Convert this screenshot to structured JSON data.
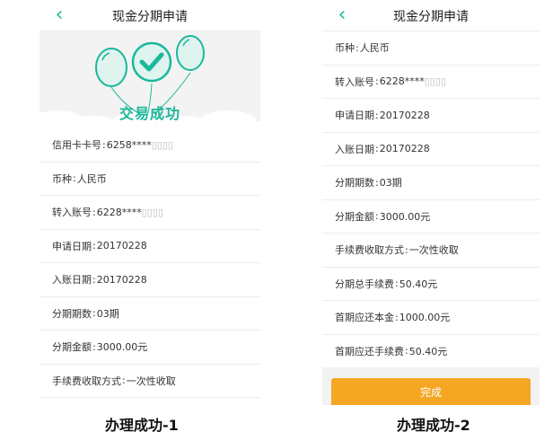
{
  "colors": {
    "accent": "#1bb89c",
    "button": "#f5a623"
  },
  "left": {
    "nav": {
      "title": "现金分期申请",
      "back_icon": "chevron-left-icon"
    },
    "success_text": "交易成功",
    "rows": [
      {
        "label": "信用卡卡号",
        "value": "6258****"
      },
      {
        "label": "币种",
        "value": "人民币"
      },
      {
        "label": "转入账号",
        "value": "6228****"
      },
      {
        "label": "申请日期",
        "value": "20170228"
      },
      {
        "label": "入账日期",
        "value": "20170228"
      },
      {
        "label": "分期期数",
        "value": "03期"
      },
      {
        "label": "分期金额",
        "value": "3000.00元"
      },
      {
        "label": "手续费收取方式",
        "value": "一次性收取"
      }
    ],
    "caption": "办理成功-1"
  },
  "right": {
    "nav": {
      "title": "现金分期申请",
      "back_icon": "chevron-left-icon"
    },
    "rows": [
      {
        "label": "币种",
        "value": "人民币"
      },
      {
        "label": "转入账号",
        "value": "6228****"
      },
      {
        "label": "申请日期",
        "value": "20170228"
      },
      {
        "label": "入账日期",
        "value": "20170228"
      },
      {
        "label": "分期期数",
        "value": "03期"
      },
      {
        "label": "分期金额",
        "value": "3000.00元"
      },
      {
        "label": "手续费收取方式",
        "value": "一次性收取"
      },
      {
        "label": "分期总手续费",
        "value": "50.40元"
      },
      {
        "label": "首期应还本金",
        "value": "1000.00元"
      },
      {
        "label": "首期应还手续费",
        "value": "50.40元"
      }
    ],
    "done_label": "完成",
    "caption": "办理成功-2"
  }
}
